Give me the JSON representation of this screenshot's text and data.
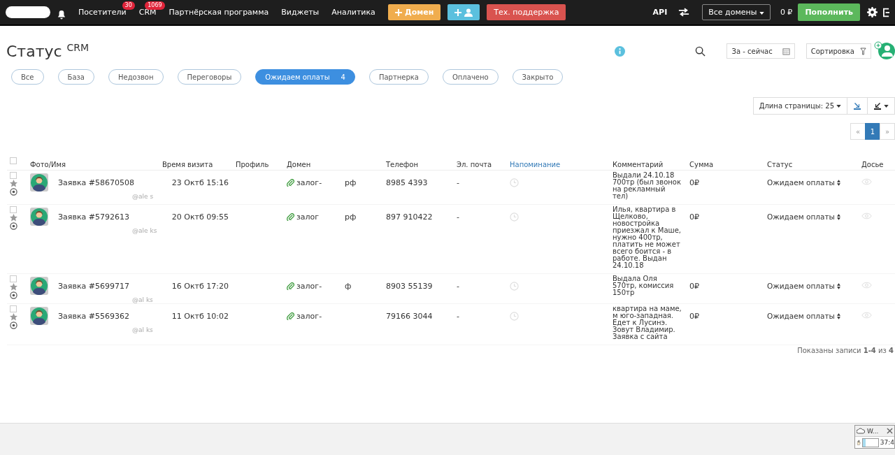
{
  "nav": {
    "items": [
      {
        "label": "Посетители",
        "badge": "30"
      },
      {
        "label": "CRM",
        "badge": "1069"
      },
      {
        "label": "Партнёрская программа"
      },
      {
        "label": "Виджеты"
      },
      {
        "label": "Аналитика"
      }
    ],
    "buttons": [
      {
        "kind": "add-domain",
        "label": "Домен"
      },
      {
        "kind": "add-user"
      },
      {
        "kind": "support",
        "label": "Тех. поддержка"
      }
    ],
    "api": "API",
    "domains": "Все домены",
    "balance": "0 ₽",
    "topup": "Пополнить"
  },
  "page": {
    "title": "Статус $^{CRM}$",
    "period": "За - сейчас",
    "sort": "Сортировка"
  },
  "filters": [
    {
      "label": "Все",
      "selected": false
    },
    {
      "label": "База",
      "selected": false
    },
    {
      "label": "Недозвон",
      "selected": false
    },
    {
      "label": "Переговоры",
      "selected": false
    },
    {
      "label": "Ожидаем оплаты",
      "count": "4",
      "selected": true
    },
    {
      "label": "Партнерка",
      "selected": false
    },
    {
      "label": "Оплачено",
      "selected": false
    },
    {
      "label": "Закрыто",
      "selected": false
    }
  ],
  "page_length": "Длина страницы: 25",
  "pagination": {
    "prev": "«",
    "pages": [
      {
        "label": "1",
        "selected": true
      }
    ],
    "next": "»"
  },
  "table": {
    "all_checked": false,
    "columns": [
      {
        "label": "Фото/Имя",
        "kind": "plain"
      },
      {
        "label": "Время визита",
        "kind": "plain"
      },
      {
        "label": "Профиль",
        "kind": "plain"
      },
      {
        "label": "Домен",
        "kind": "plain"
      },
      {
        "label": "Телефон",
        "kind": "plain"
      },
      {
        "label": "Эл. почта",
        "kind": "plain"
      },
      {
        "label": "Напоминание",
        "kind": "link"
      },
      {
        "label": "Комментарий",
        "kind": "plain"
      },
      {
        "label": "Сумма",
        "kind": "plain"
      },
      {
        "label": "Статус",
        "kind": "plain"
      },
      {
        "label": "Досье",
        "kind": "plain"
      }
    ],
    "rows": [
      {
        "checked": false,
        "name": "Заявка #58670508",
        "handle": "@ale s",
        "time": "23 Октб 15:16",
        "domain": "залог-",
        "tld": "рф",
        "phone": "8985 4393",
        "email": "-",
        "comment": "Выдали 24.10.18 700тр (был звонок на рекламный тел)",
        "sum": "0₽",
        "status": "Ожидаем оплаты"
      },
      {
        "checked": false,
        "name": "Заявка #5792613",
        "handle": "@ale ks",
        "time": "20 Октб 09:55",
        "domain": "залог",
        "tld": "рф",
        "phone": "897 910422",
        "email": "-",
        "comment": "Илья, квартира в Щелково, новостройка приезжал к Маше, нужно 400тр, платить не может всего боится - в работе. Выдан 24.10.18",
        "sum": "0₽",
        "status": "Ожидаем оплаты"
      },
      {
        "checked": false,
        "name": "Заявка #5699717",
        "handle": "@al ks",
        "time": "16 Октб 17:20",
        "domain": "залог-",
        "tld": "ф",
        "phone": "8903 55139",
        "email": "-",
        "comment": "Выдала Оля 570тр, комиссия 150тр",
        "sum": "0₽",
        "status": "Ожидаем оплаты"
      },
      {
        "checked": false,
        "name": "Заявка #5569362",
        "handle": "@al ks",
        "time": "11 Октб 10:02",
        "domain": "залог-",
        "phone": "79166 3044",
        "email": "-",
        "comment": "квартира на маме, м юго-западная. Едет к Лусинэ. Зовут Владимир. Заявка с сайта",
        "sum": "0₽",
        "status": "Ожидаем оплаты"
      }
    ]
  },
  "records_info": "Показаны записи **1-4** из **4**",
  "tray": {
    "title": "W...",
    "time": "37:4",
    "level": 0.2
  }
}
